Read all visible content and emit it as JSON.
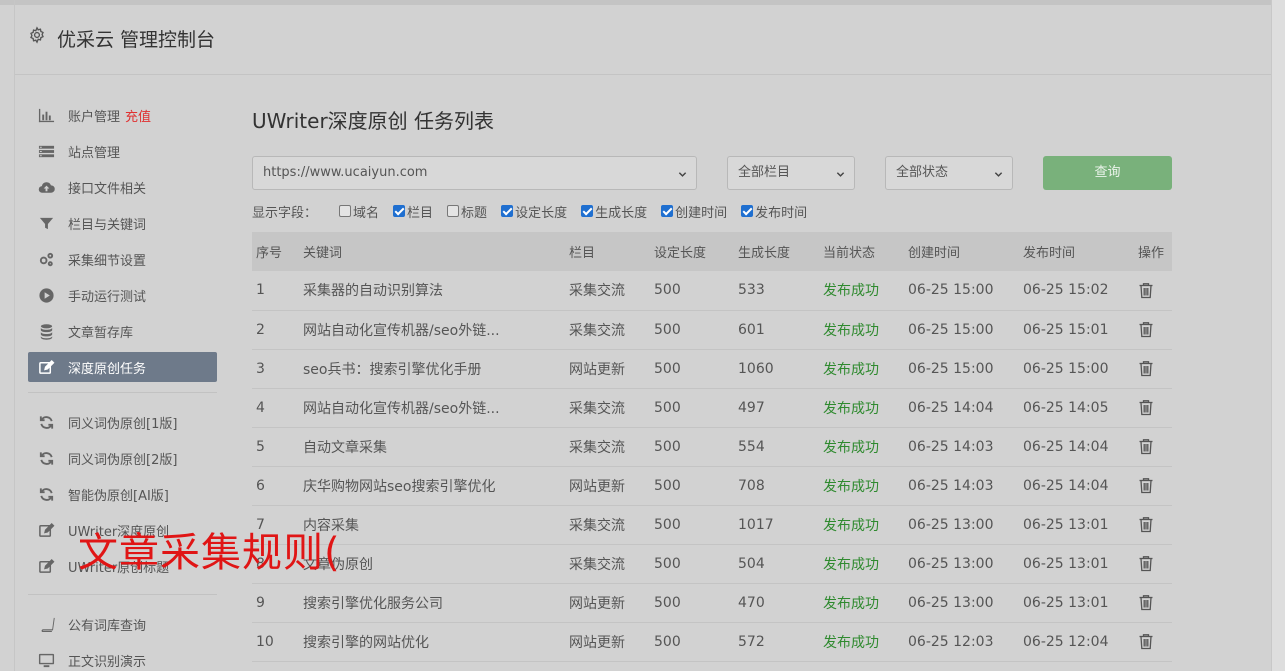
{
  "header": {
    "title": "优采云 管理控制台"
  },
  "sidebar": {
    "items": [
      {
        "label": "账户管理",
        "badge": "充值",
        "icon": "bar-chart-icon"
      },
      {
        "label": "站点管理",
        "icon": "list-icon"
      },
      {
        "label": "接口文件相关",
        "icon": "cloud-upload-icon"
      },
      {
        "label": "栏目与关键词",
        "icon": "filter-icon"
      },
      {
        "label": "采集细节设置",
        "icon": "gears-icon"
      },
      {
        "label": "手动运行测试",
        "icon": "play-icon"
      },
      {
        "label": "文章暂存库",
        "icon": "database-icon"
      },
      {
        "label": "深度原创任务",
        "icon": "edit-icon"
      }
    ],
    "group2": [
      {
        "label": "同义词伪原创[1版]",
        "icon": "refresh-icon"
      },
      {
        "label": "同义词伪原创[2版]",
        "icon": "refresh-icon"
      },
      {
        "label": "智能伪原创[AI版]",
        "icon": "refresh-icon"
      },
      {
        "label": "UWriter深度原创",
        "icon": "edit-icon"
      },
      {
        "label": "UWriter原创标题",
        "icon": "edit-icon"
      }
    ],
    "group3": [
      {
        "label": "公有词库查询",
        "icon": "book-icon"
      },
      {
        "label": "正文识别演示",
        "icon": "monitor-icon"
      }
    ]
  },
  "main": {
    "title": "UWriter深度原创 任务列表",
    "site_select": "https://www.ucaiyun.com",
    "column_select": "全部栏目",
    "status_select": "全部状态",
    "query_label": "查询",
    "fields_label": "显示字段：",
    "fields": [
      {
        "label": "域名",
        "checked": false
      },
      {
        "label": "栏目",
        "checked": true
      },
      {
        "label": "标题",
        "checked": false
      },
      {
        "label": "设定长度",
        "checked": true
      },
      {
        "label": "生成长度",
        "checked": true
      },
      {
        "label": "创建时间",
        "checked": true
      },
      {
        "label": "发布时间",
        "checked": true
      }
    ]
  },
  "table": {
    "headers": [
      "序号",
      "关键词",
      "栏目",
      "设定长度",
      "生成长度",
      "当前状态",
      "创建时间",
      "发布时间",
      "操作"
    ],
    "rows": [
      [
        "1",
        "采集器的自动识别算法",
        "采集交流",
        "500",
        "533",
        "发布成功",
        "06-25 15:00",
        "06-25 15:02"
      ],
      [
        "2",
        "网站自动化宣传机器/seo外链...",
        "采集交流",
        "500",
        "601",
        "发布成功",
        "06-25 15:00",
        "06-25 15:01"
      ],
      [
        "3",
        "seo兵书：搜索引擎优化手册",
        "网站更新",
        "500",
        "1060",
        "发布成功",
        "06-25 15:00",
        "06-25 15:00"
      ],
      [
        "4",
        "网站自动化宣传机器/seo外链...",
        "采集交流",
        "500",
        "497",
        "发布成功",
        "06-25 14:04",
        "06-25 14:05"
      ],
      [
        "5",
        "自动文章采集",
        "采集交流",
        "500",
        "554",
        "发布成功",
        "06-25 14:03",
        "06-25 14:04"
      ],
      [
        "6",
        "庆华购物网站seo搜索引擎优化",
        "网站更新",
        "500",
        "708",
        "发布成功",
        "06-25 14:03",
        "06-25 14:04"
      ],
      [
        "7",
        "内容采集",
        "采集交流",
        "500",
        "1017",
        "发布成功",
        "06-25 13:00",
        "06-25 13:01"
      ],
      [
        "8",
        "文章伪原创",
        "采集交流",
        "500",
        "504",
        "发布成功",
        "06-25 13:00",
        "06-25 13:01"
      ],
      [
        "9",
        "搜索引擎优化服务公司",
        "网站更新",
        "500",
        "470",
        "发布成功",
        "06-25 13:00",
        "06-25 13:01"
      ],
      [
        "10",
        "搜索引擎的网站优化",
        "网站更新",
        "500",
        "572",
        "发布成功",
        "06-25 12:03",
        "06-25 12:04"
      ]
    ]
  },
  "overlay": {
    "watermark": "文章采集规则("
  },
  "colors": {
    "query_button": "#79b17b",
    "status_success": "#2f8a2f",
    "active_nav": "#6e7a8a",
    "badge": "#e03030",
    "overlay_text": "#e01515"
  }
}
